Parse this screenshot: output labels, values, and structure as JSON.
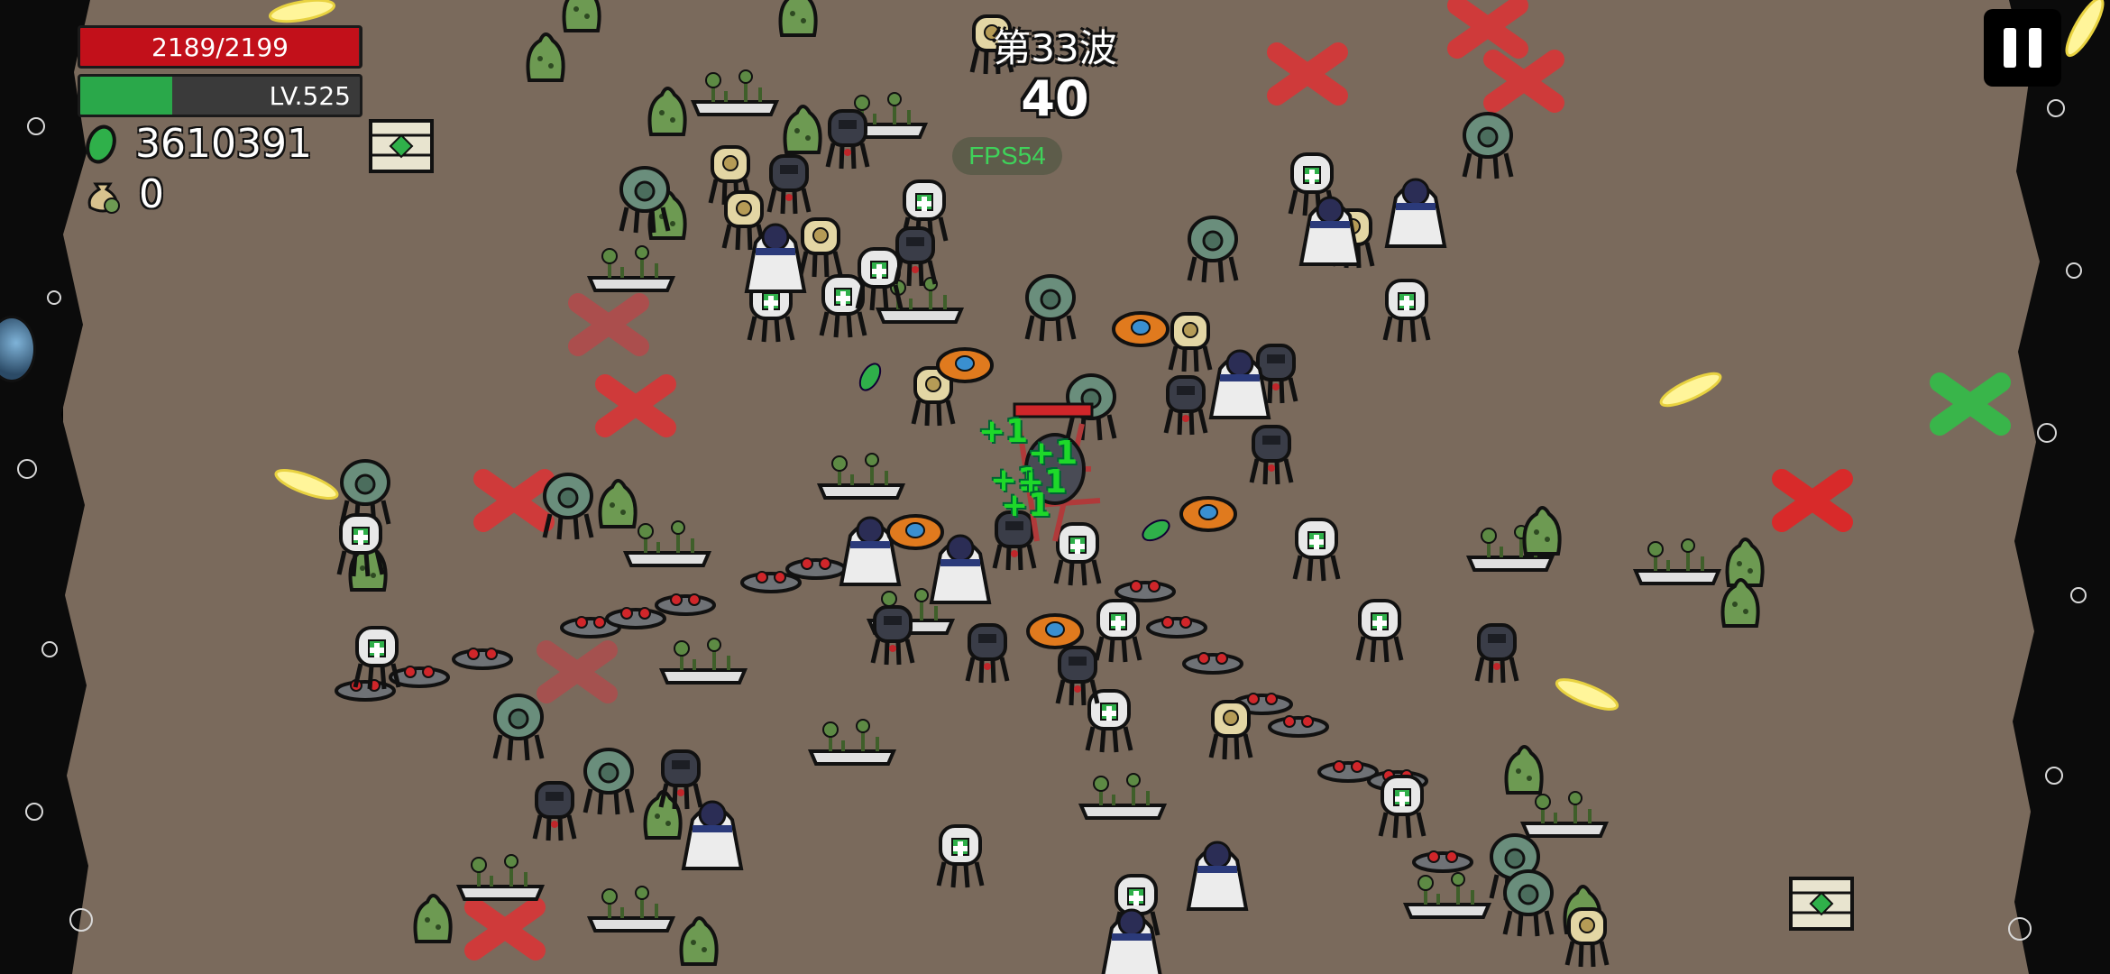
{
  "hud": {
    "hp_text": "2189/2199",
    "hp_current": 2189,
    "hp_max": 2199,
    "level_text": "LV.525",
    "xp_fraction": 0.33,
    "gold_icon": "green-gem-icon",
    "gold_value": "3610391",
    "bag_icon": "money-bag-icon",
    "bag_value": "0",
    "wave_label": "第33波",
    "wave_timer": "40",
    "fps_text": "FPS54",
    "pause_icon": "pause-icon"
  },
  "effects": {
    "float_texts": [
      "+1",
      "+1",
      "+1",
      "+1",
      "+1"
    ]
  },
  "colors": {
    "ground": "#7a6a5c",
    "hp_red": "#c2101a",
    "xp_green": "#2aa84a",
    "heal_green": "#1ed82a",
    "fps_green": "#3fd25a"
  }
}
